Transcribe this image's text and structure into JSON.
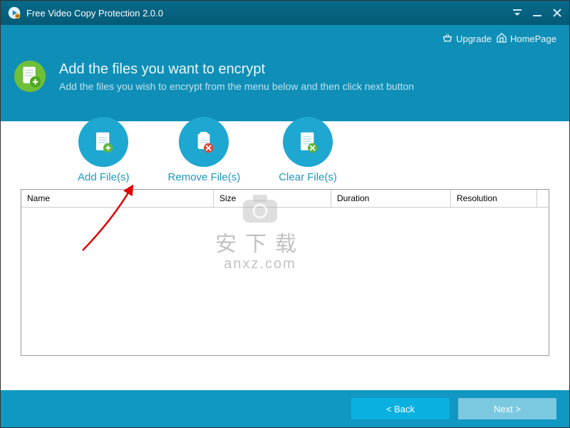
{
  "titlebar": {
    "title": "Free Video Copy Protection 2.0.0"
  },
  "header": {
    "upgrade": "Upgrade",
    "homepage": "HomePage",
    "heading": "Add the files you want to encrypt",
    "subheading": "Add the files you wish to encrypt from the menu below and then click next button"
  },
  "toolbar": {
    "add": "Add File(s)",
    "remove": "Remove File(s)",
    "clear": "Clear File(s)"
  },
  "table": {
    "columns": {
      "c0": "Name",
      "c1": "Size",
      "c2": "Duration",
      "c3": "Resolution"
    }
  },
  "footer": {
    "back": "< Back",
    "next": "Next >"
  },
  "watermark": {
    "line1": "安下载",
    "line2": "anxz.com"
  },
  "colors": {
    "headerBg": "#0f8fb7",
    "footerBg": "#1097c2",
    "circle": "#1ea7d0",
    "toolbarText": "#1e98bf"
  }
}
